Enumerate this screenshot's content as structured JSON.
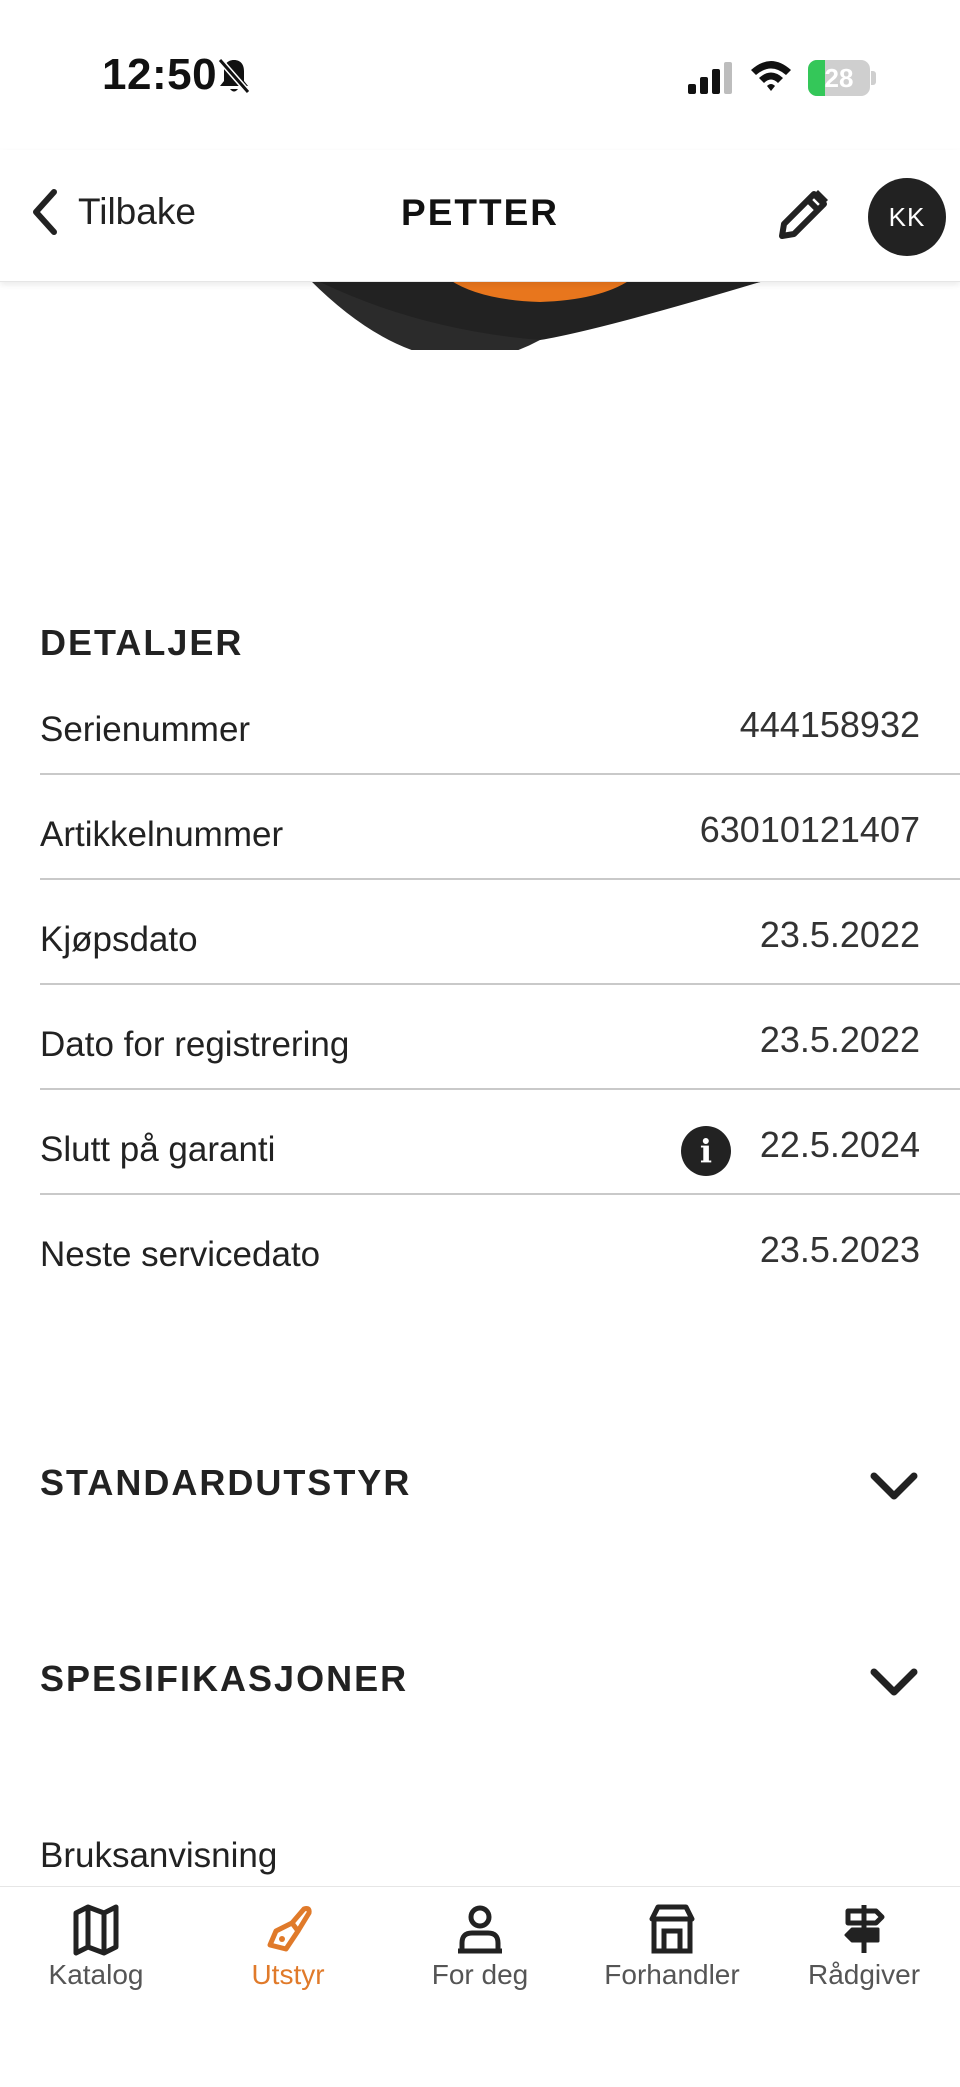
{
  "status_bar": {
    "time": "12:50",
    "battery": "28",
    "battery_level": 0.28
  },
  "nav": {
    "back_label": "Tilbake",
    "title": "PETTER",
    "avatar_initials": "KK"
  },
  "details": {
    "heading": "DETALJER",
    "rows": [
      {
        "label": "Serienummer",
        "value": "444158932"
      },
      {
        "label": "Artikkelnummer",
        "value": "63010121407"
      },
      {
        "label": "Kjøpsdato",
        "value": "23.5.2022"
      },
      {
        "label": "Dato for registrering",
        "value": "23.5.2022"
      },
      {
        "label": "Slutt på garanti",
        "value": "22.5.2024",
        "info": "i"
      },
      {
        "label": "Neste servicedato",
        "value": "23.5.2023"
      }
    ]
  },
  "accordions": [
    {
      "title": "STANDARDUTSTYR"
    },
    {
      "title": "SPESIFIKASJONER"
    }
  ],
  "manual_link": "Bruksanvisning",
  "tabs": [
    {
      "label": "Katalog",
      "icon": "map-icon"
    },
    {
      "label": "Utstyr",
      "icon": "chainsaw-icon",
      "active": true
    },
    {
      "label": "For deg",
      "icon": "person-icon"
    },
    {
      "label": "Forhandler",
      "icon": "store-icon"
    },
    {
      "label": "Rådgiver",
      "icon": "signpost-icon"
    }
  ],
  "colors": {
    "accent": "#e07a2a",
    "text": "#222222",
    "divider": "#c9c9c9",
    "battery_green": "#34c759"
  }
}
